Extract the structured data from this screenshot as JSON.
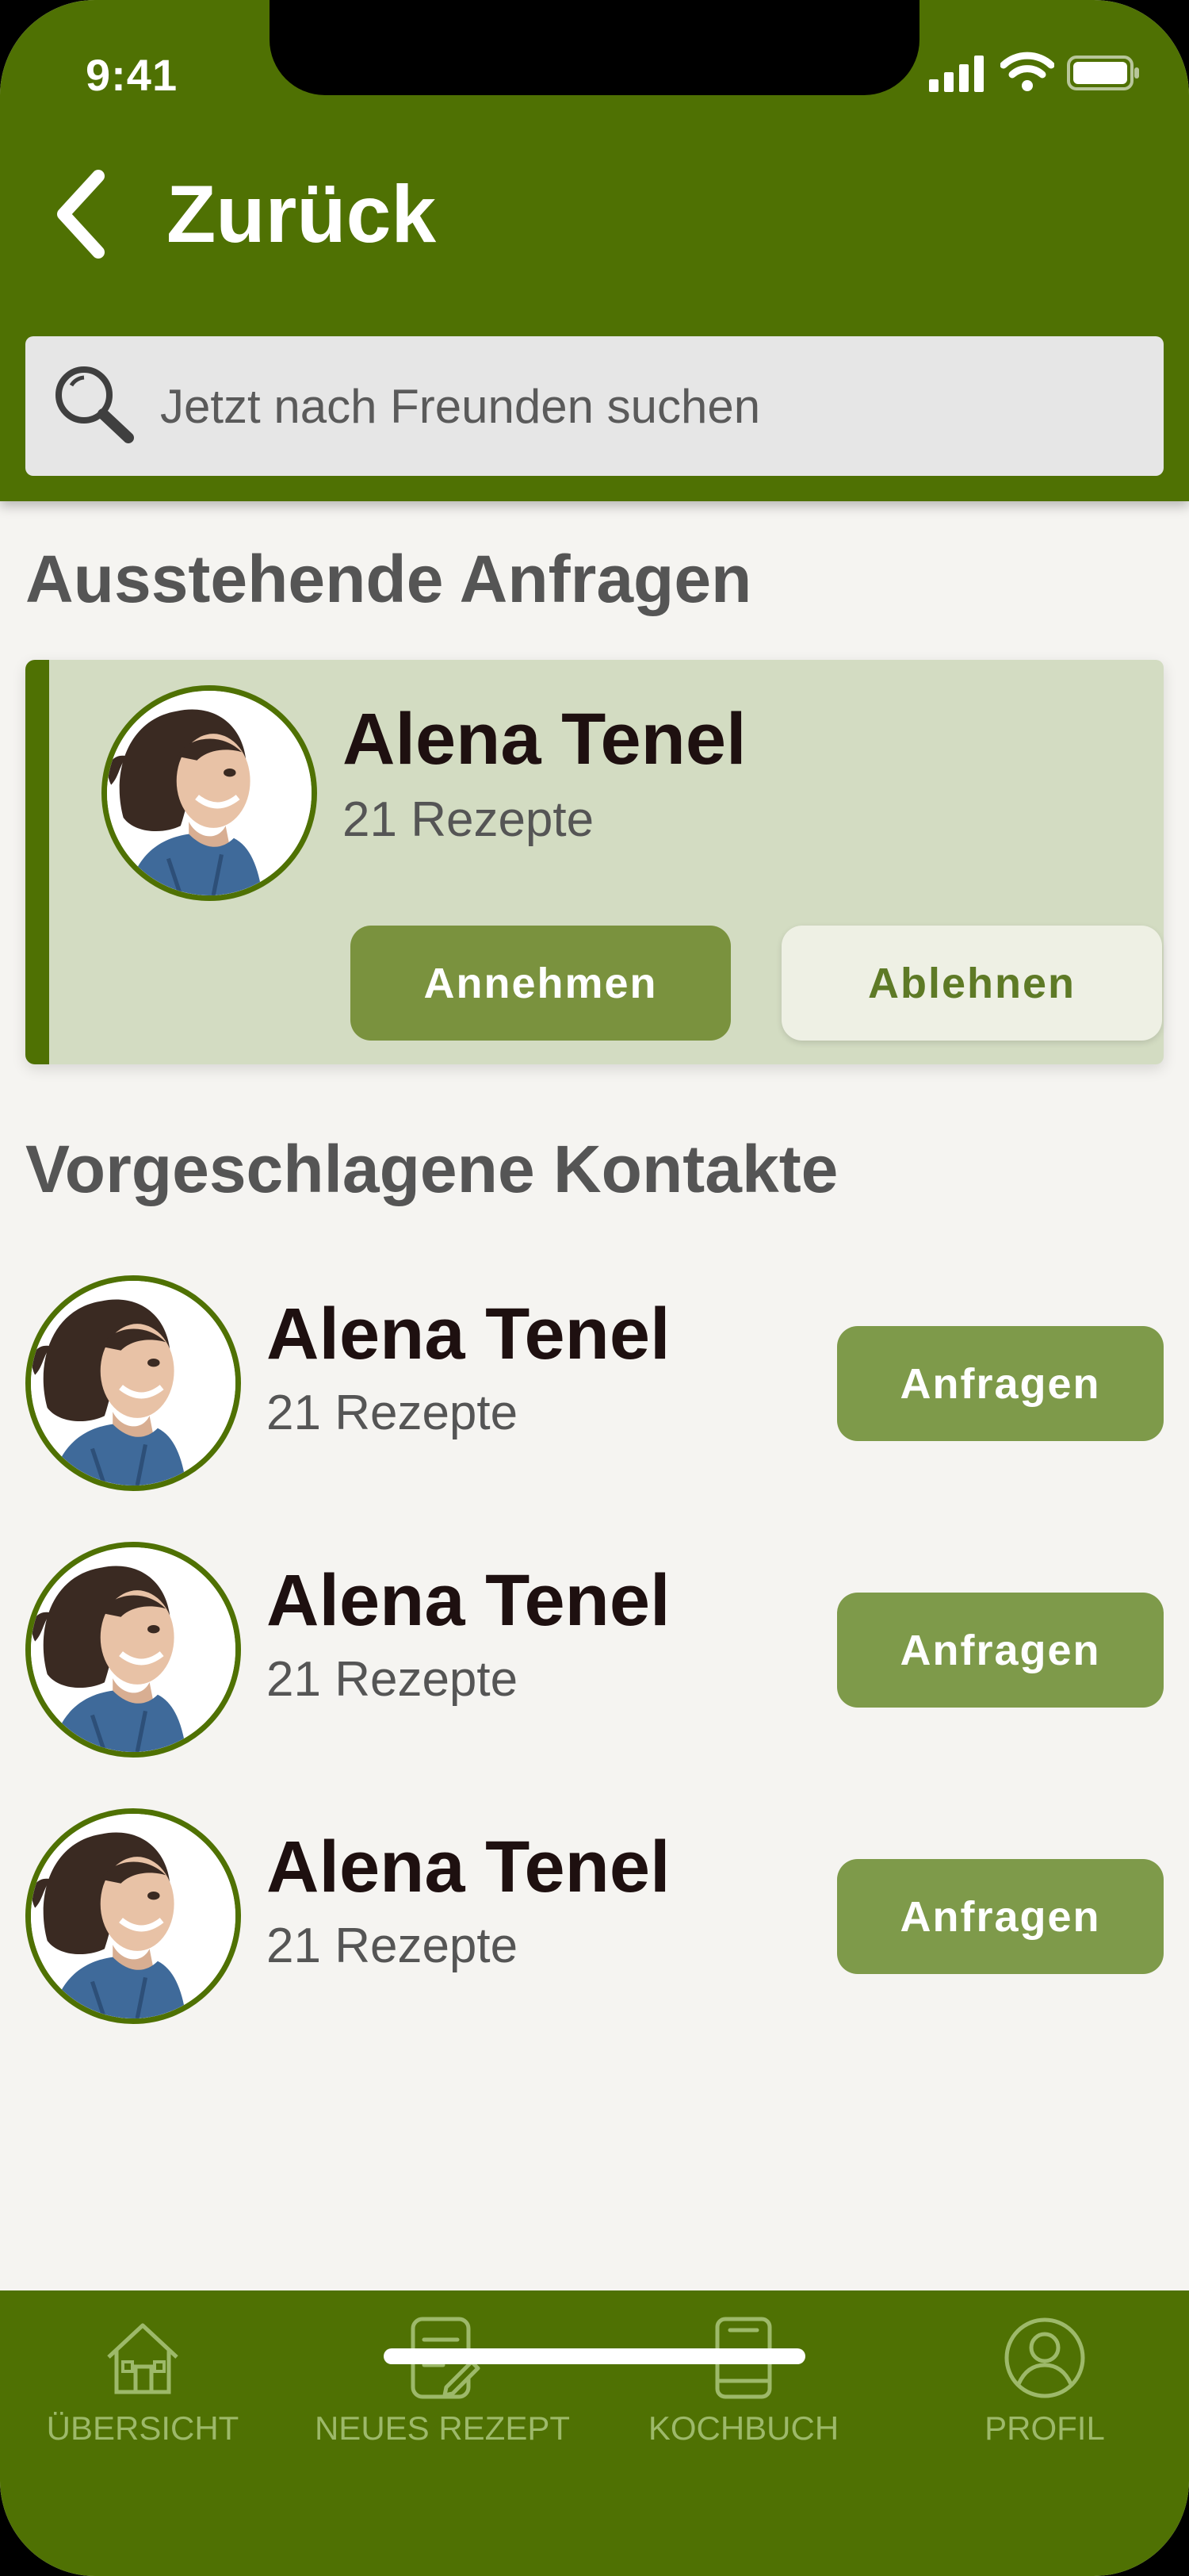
{
  "status_bar": {
    "time": "9:41"
  },
  "header": {
    "back_label": "Zurück"
  },
  "search": {
    "placeholder": "Jetzt nach Freunden suchen"
  },
  "pending": {
    "title": "Ausstehende Anfragen",
    "request": {
      "name": "Alena Tenel",
      "recipes": "21 Rezepte",
      "accept_label": "Annehmen",
      "decline_label": "Ablehnen"
    }
  },
  "suggested": {
    "title": "Vorgeschlagene Kontakte",
    "contacts": [
      {
        "name": "Alena Tenel",
        "recipes": "21 Rezepte",
        "button_label": "Anfragen"
      },
      {
        "name": "Alena Tenel",
        "recipes": "21 Rezepte",
        "button_label": "Anfragen"
      },
      {
        "name": "Alena Tenel",
        "recipes": "21 Rezepte",
        "button_label": "Anfragen"
      }
    ]
  },
  "bottom_nav": {
    "items": [
      {
        "label": "ÜBERSICHT",
        "icon": "home-icon"
      },
      {
        "label": "NEUES REZEPT",
        "icon": "new-recipe-icon"
      },
      {
        "label": "KOCHBUCH",
        "icon": "cookbook-icon"
      },
      {
        "label": "PROFIL",
        "icon": "profile-icon"
      }
    ]
  },
  "colors": {
    "primary": "#4f7103",
    "button": "#7e9a4a",
    "card": "#d3dcc2",
    "background": "#f5f4f1",
    "nav_label": "#9db96a"
  }
}
